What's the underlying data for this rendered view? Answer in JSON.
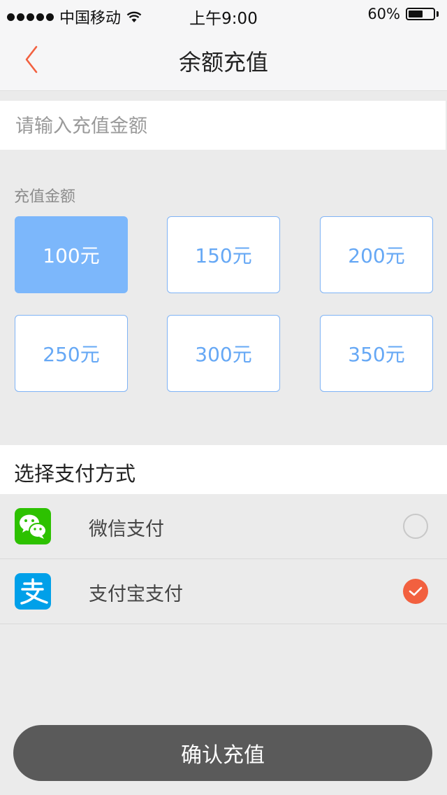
{
  "status_bar": {
    "carrier": "中国移动",
    "time": "上午9:00",
    "battery": "60%",
    "battery_level": 0.6,
    "signal_icon": "signal-dots-icon",
    "wifi_icon": "wifi-icon",
    "battery_icon": "battery-icon"
  },
  "nav": {
    "title": "余额充值",
    "back_icon": "chevron-left-icon",
    "back_color": "#f2603f"
  },
  "amount_input": {
    "placeholder": "请输入充值金额",
    "value": ""
  },
  "amount_section": {
    "label": "充值金额",
    "options": [
      "100元",
      "150元",
      "200元",
      "250元",
      "300元",
      "350元"
    ],
    "selected": "100元",
    "accent_color": "#7cb7fb"
  },
  "payment": {
    "title": "选择支付方式",
    "methods": [
      {
        "label": "微信支付",
        "icon": "wechat-icon",
        "checked": false
      },
      {
        "label": "支付宝支付",
        "icon": "alipay-icon",
        "checked": true
      }
    ],
    "check_color": "#f2603f"
  },
  "confirm": {
    "label": "确认充值"
  }
}
